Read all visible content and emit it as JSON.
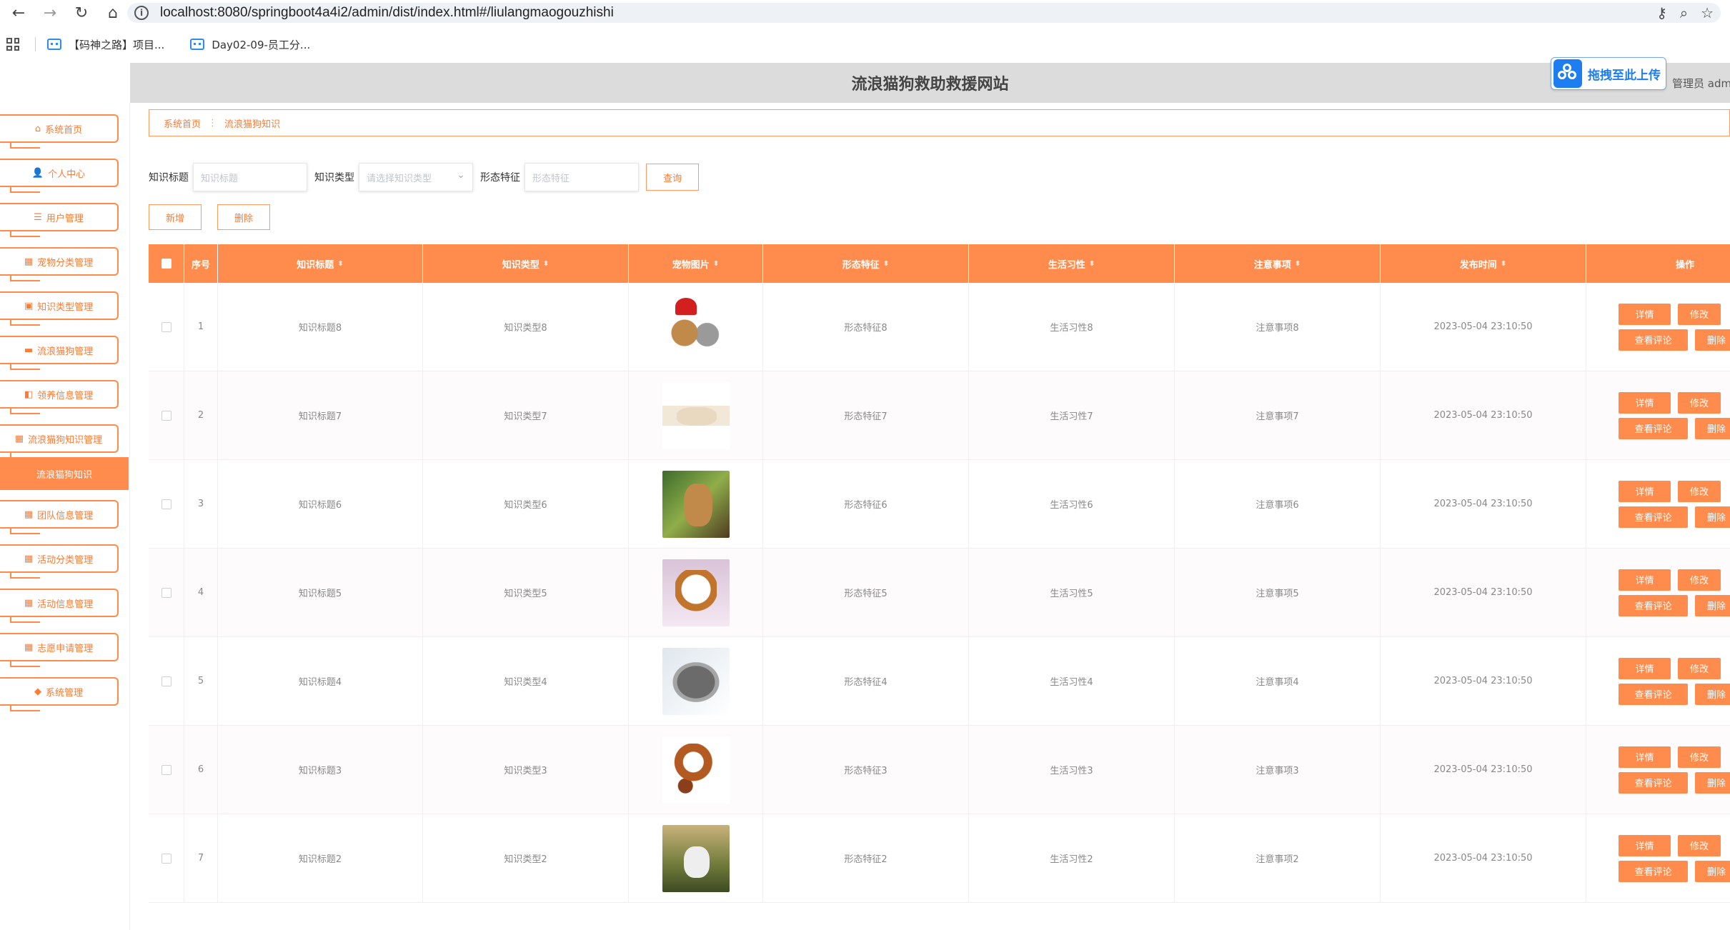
{
  "browser": {
    "url": "localhost:8080/springboot4a4i2/admin/dist/index.html#/liulangmaogouzhishi",
    "bookmarks": [
      "【码神之路】项目...",
      "Day02-09-员工分..."
    ]
  },
  "header": {
    "title": "流浪猫狗救助救援网站",
    "upload_label": "拖拽至此上传",
    "admin_text": "管理员 adm"
  },
  "sidebar": {
    "items": [
      {
        "icon": "home-icon",
        "glyph": "⌂",
        "label": "系统首页"
      },
      {
        "icon": "user-icon",
        "glyph": "👤",
        "label": "个人中心"
      },
      {
        "icon": "list-icon",
        "glyph": "☰",
        "label": "用户管理"
      },
      {
        "icon": "grid-icon",
        "glyph": "▦",
        "label": "宠物分类管理"
      },
      {
        "icon": "doc-icon",
        "glyph": "▣",
        "label": "知识类型管理"
      },
      {
        "icon": "monitor-icon",
        "glyph": "▬",
        "label": "流浪猫狗管理"
      },
      {
        "icon": "briefcase-icon",
        "glyph": "◧",
        "label": "领养信息管理"
      },
      {
        "icon": "grid-icon",
        "glyph": "▦",
        "label": "流浪猫狗知识管理"
      },
      {
        "icon": "",
        "glyph": "",
        "label": "流浪猫狗知识"
      },
      {
        "icon": "grid-icon",
        "glyph": "▦",
        "label": "团队信息管理"
      },
      {
        "icon": "grid-icon",
        "glyph": "▦",
        "label": "活动分类管理"
      },
      {
        "icon": "grid-icon",
        "glyph": "▦",
        "label": "活动信息管理"
      },
      {
        "icon": "grid-icon",
        "glyph": "▦",
        "label": "志愿申请管理"
      },
      {
        "icon": "shield-icon",
        "glyph": "◆",
        "label": "系统管理"
      }
    ]
  },
  "breadcrumb": {
    "home": "系统首页",
    "sep": "⋮",
    "current": "流浪猫狗知识"
  },
  "search": {
    "title_label": "知识标题",
    "title_placeholder": "知识标题",
    "type_label": "知识类型",
    "type_placeholder": "请选择知识类型",
    "feature_label": "形态特征",
    "feature_placeholder": "形态特征",
    "query_label": "查询"
  },
  "actions": {
    "add_label": "新增",
    "delete_label": "删除"
  },
  "table": {
    "columns": [
      "序号",
      "知识标题",
      "知识类型",
      "宠物图片",
      "形态特征",
      "生活习性",
      "注意事项",
      "发布时间",
      "操作"
    ],
    "op_labels": {
      "detail": "详情",
      "edit": "修改",
      "comments": "查看评论",
      "delete": "删除"
    },
    "rows": [
      {
        "idx": "1",
        "title": "知识标题8",
        "type": "知识类型8",
        "feature": "形态特征8",
        "habit": "生活习性8",
        "note": "注意事项8",
        "time": "2023-05-04 23:10:50"
      },
      {
        "idx": "2",
        "title": "知识标题7",
        "type": "知识类型7",
        "feature": "形态特征7",
        "habit": "生活习性7",
        "note": "注意事项7",
        "time": "2023-05-04 23:10:50"
      },
      {
        "idx": "3",
        "title": "知识标题6",
        "type": "知识类型6",
        "feature": "形态特征6",
        "habit": "生活习性6",
        "note": "注意事项6",
        "time": "2023-05-04 23:10:50"
      },
      {
        "idx": "4",
        "title": "知识标题5",
        "type": "知识类型5",
        "feature": "形态特征5",
        "habit": "生活习性5",
        "note": "注意事项5",
        "time": "2023-05-04 23:10:50"
      },
      {
        "idx": "5",
        "title": "知识标题4",
        "type": "知识类型4",
        "feature": "形态特征4",
        "habit": "生活习性4",
        "note": "注意事项4",
        "time": "2023-05-04 23:10:50"
      },
      {
        "idx": "6",
        "title": "知识标题3",
        "type": "知识类型3",
        "feature": "形态特征3",
        "habit": "生活习性3",
        "note": "注意事项3",
        "time": "2023-05-04 23:10:50"
      },
      {
        "idx": "7",
        "title": "知识标题2",
        "type": "知识类型2",
        "feature": "形态特征2",
        "habit": "生活习性2",
        "note": "注意事项2",
        "time": "2023-05-04 23:10:50"
      }
    ]
  },
  "colors": {
    "accent": "#ff8c4d",
    "header_bg": "#dcdcdc",
    "upload_blue": "#1f7df2"
  }
}
